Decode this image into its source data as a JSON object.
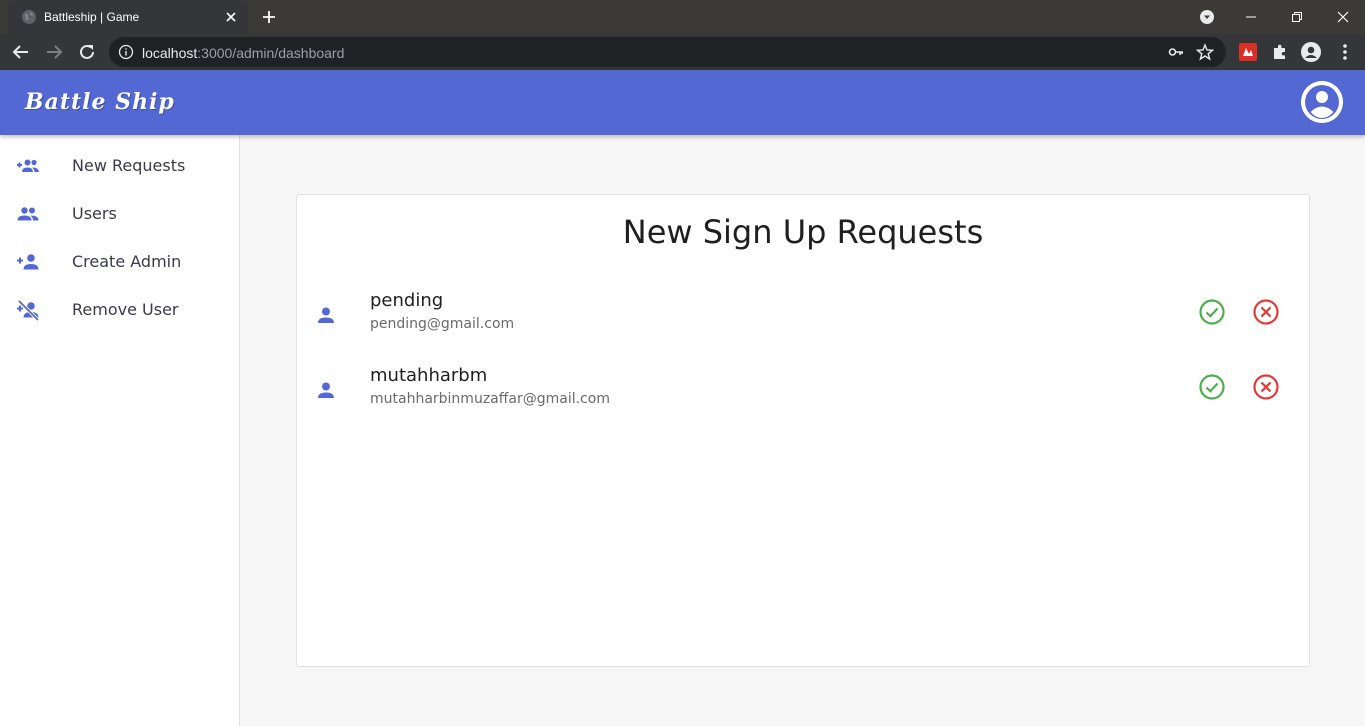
{
  "browser": {
    "tab_title": "Battleship | Game",
    "url_host": "localhost",
    "url_rest": ":3000/admin/dashboard"
  },
  "app": {
    "logo": "Battle Ship"
  },
  "sidebar": {
    "items": [
      {
        "label": "New Requests",
        "icon": "group-add-icon"
      },
      {
        "label": "Users",
        "icon": "people-icon"
      },
      {
        "label": "Create Admin",
        "icon": "person-add-icon"
      },
      {
        "label": "Remove User",
        "icon": "person-off-icon"
      }
    ]
  },
  "main": {
    "title": "New Sign Up Requests",
    "requests": [
      {
        "name": "pending",
        "email": "pending@gmail.com"
      },
      {
        "name": "mutahharbm",
        "email": "mutahharbinmuzaffar@gmail.com"
      }
    ]
  },
  "colors": {
    "brand": "#5468d4",
    "accept": "#4caf50",
    "reject": "#e53935"
  }
}
